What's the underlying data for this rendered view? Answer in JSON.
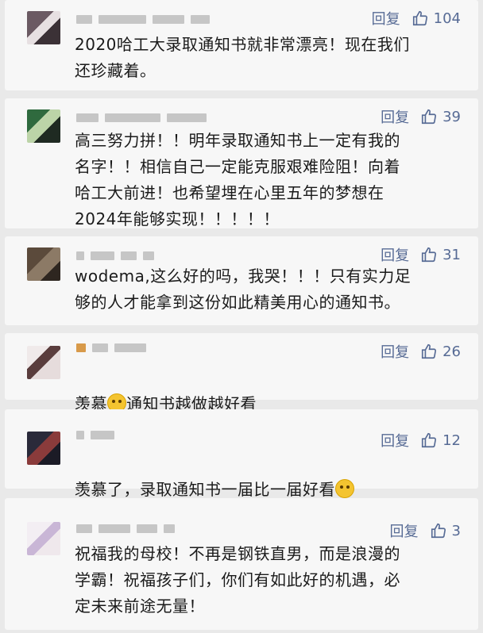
{
  "reply_label": "回复",
  "accent_color": "#576b95",
  "comments": [
    {
      "likes": "104",
      "text": "2020哈工大录取通知书就非常漂亮！现在我们\n还珍藏着。"
    },
    {
      "likes": "39",
      "text": "高三努力拼！！明年录取通知书上一定有我的\n名字！！相信自己一定能克服艰难险阻！向着\n哈工大前进！也希望埋在心里五年的梦想在\n2024年能够实现！！！！！"
    },
    {
      "likes": "31",
      "text": "wodema,这么好的吗，我哭！！！只有实力足\n够的人才能拿到这份如此精美用心的通知书。"
    },
    {
      "likes": "26",
      "text_before": "羡慕",
      "emoji": "crying-face-emoji",
      "text_after": "通知书越做越好看"
    },
    {
      "likes": "12",
      "text_before": "羡慕了，录取通知书一届比一届好看",
      "emoji": "smiling-face-emoji",
      "text_after": ""
    },
    {
      "likes": "3",
      "text": "祝福我的母校！不再是钢铁直男，而是浪漫的\n学霸！祝福孩子们，你们有如此好的机遇，必\n定未来前途无量！"
    }
  ]
}
